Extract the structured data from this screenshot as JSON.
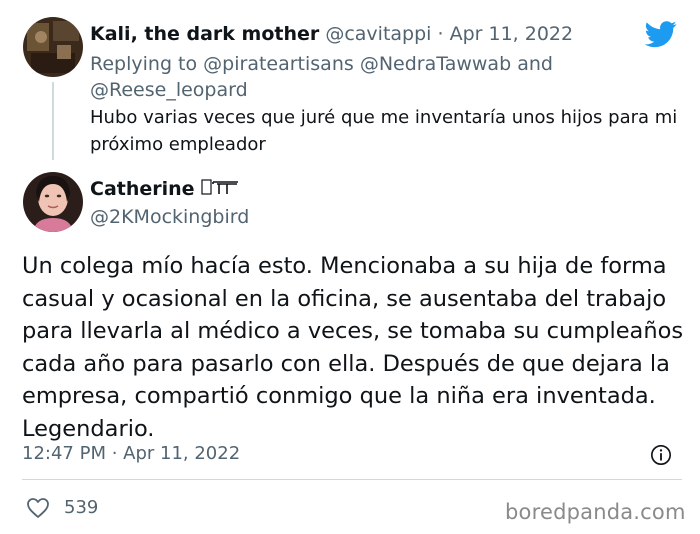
{
  "reply": {
    "author_name": "Kali, the dark mother",
    "author_handle": "@cavitappi",
    "separator": "·",
    "date": "Apr 11, 2022",
    "replying_prefix": "Replying to",
    "mention_1": "@pirateartisans",
    "mention_2": "@NedraTawwab",
    "and_word": "and",
    "mention_3": "@Reese_leopard",
    "text": "Hubo varias veces que juré que me inventaría unos hijos para mi próximo empleador"
  },
  "main": {
    "author_name": "Catherine",
    "name_emoji_icon": "gun-emoji-icon",
    "author_handle": "@2KMockingbird",
    "text": "Un colega mío hacía esto. Mencionaba a su hija de forma casual y ocasional en la oficina, se ausentaba del trabajo para llevarla al médico a veces, se tomaba su cumpleaños cada año para pasarlo con ella. Después de que dejara la empresa, compartió conmigo que la niña era inventada. Legendario.",
    "timestamp": "12:47 PM · Apr 11, 2022",
    "like_count": "539"
  },
  "colors": {
    "twitter_blue": "#1d9bf0",
    "secondary_text": "#536471",
    "divider": "#cfd9de"
  },
  "watermark": "boredpanda.com"
}
